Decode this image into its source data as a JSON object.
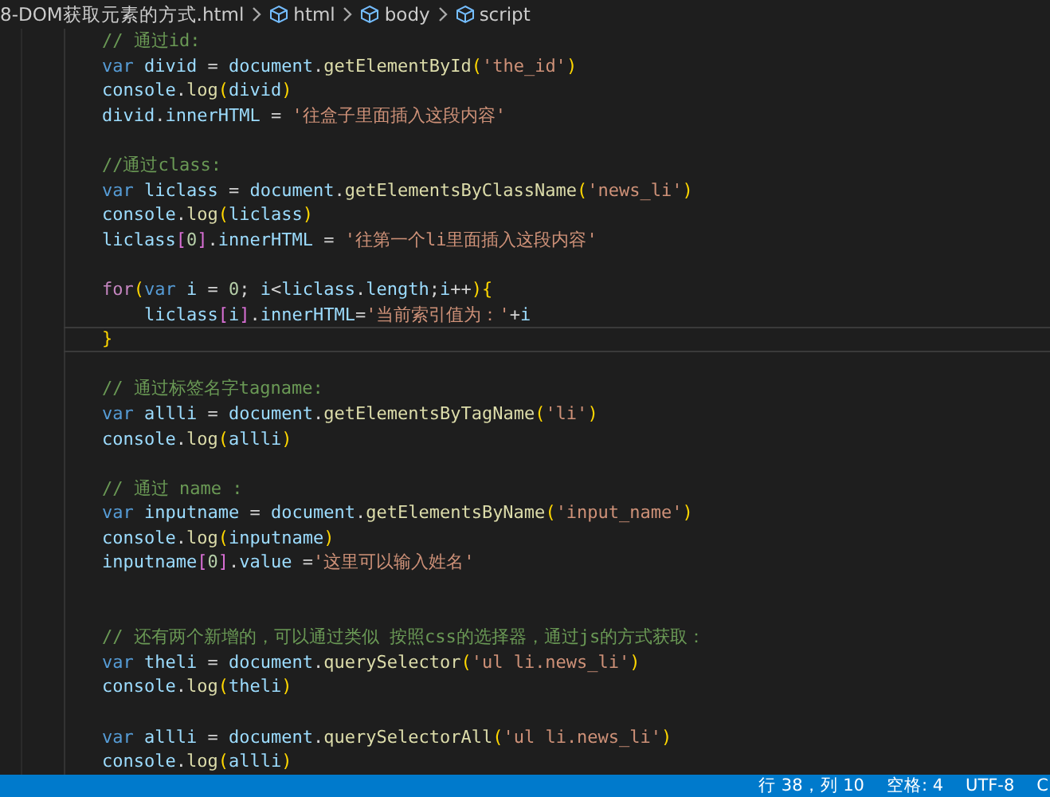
{
  "breadcrumb": [
    {
      "kind": "file",
      "text": "8-DOM获取元素的方式.html"
    },
    {
      "kind": "element",
      "text": "html"
    },
    {
      "kind": "element",
      "text": "body"
    },
    {
      "kind": "element",
      "text": "script"
    }
  ],
  "code_lines": [
    {
      "current": false,
      "tokens": [
        {
          "kind": "comment",
          "text": "// 通过id:"
        }
      ]
    },
    {
      "current": false,
      "tokens": [
        {
          "kind": "keyword",
          "text": "var "
        },
        {
          "kind": "variable",
          "text": "divid"
        },
        {
          "kind": "plain",
          "text": " = "
        },
        {
          "kind": "variable",
          "text": "document"
        },
        {
          "kind": "plain",
          "text": "."
        },
        {
          "kind": "function",
          "text": "getElementById"
        },
        {
          "kind": "bracket",
          "text": "("
        },
        {
          "kind": "string",
          "text": "'the_id'"
        },
        {
          "kind": "bracket",
          "text": ")"
        }
      ]
    },
    {
      "current": false,
      "tokens": [
        {
          "kind": "variable",
          "text": "console"
        },
        {
          "kind": "plain",
          "text": "."
        },
        {
          "kind": "function",
          "text": "log"
        },
        {
          "kind": "bracket",
          "text": "("
        },
        {
          "kind": "variable",
          "text": "divid"
        },
        {
          "kind": "bracket",
          "text": ")"
        }
      ]
    },
    {
      "current": false,
      "tokens": [
        {
          "kind": "variable",
          "text": "divid"
        },
        {
          "kind": "plain",
          "text": "."
        },
        {
          "kind": "variable",
          "text": "innerHTML"
        },
        {
          "kind": "plain",
          "text": " = "
        },
        {
          "kind": "string",
          "text": "'往盒子里面插入这段内容'"
        }
      ]
    },
    {
      "current": false
    },
    {
      "current": false,
      "tokens": [
        {
          "kind": "comment",
          "text": "//通过class:"
        }
      ]
    },
    {
      "current": false,
      "tokens": [
        {
          "kind": "keyword",
          "text": "var "
        },
        {
          "kind": "variable",
          "text": "liclass"
        },
        {
          "kind": "plain",
          "text": " = "
        },
        {
          "kind": "variable",
          "text": "document"
        },
        {
          "kind": "plain",
          "text": "."
        },
        {
          "kind": "function",
          "text": "getElementsByClassName"
        },
        {
          "kind": "bracket",
          "text": "("
        },
        {
          "kind": "string",
          "text": "'news_li'"
        },
        {
          "kind": "bracket",
          "text": ")"
        }
      ]
    },
    {
      "current": false,
      "tokens": [
        {
          "kind": "variable",
          "text": "console"
        },
        {
          "kind": "plain",
          "text": "."
        },
        {
          "kind": "function",
          "text": "log"
        },
        {
          "kind": "bracket",
          "text": "("
        },
        {
          "kind": "variable",
          "text": "liclass"
        },
        {
          "kind": "bracket",
          "text": ")"
        }
      ]
    },
    {
      "current": false,
      "tokens": [
        {
          "kind": "variable",
          "text": "liclass"
        },
        {
          "kind": "bracket2",
          "text": "["
        },
        {
          "kind": "number",
          "text": "0"
        },
        {
          "kind": "bracket2",
          "text": "]"
        },
        {
          "kind": "plain",
          "text": "."
        },
        {
          "kind": "variable",
          "text": "innerHTML"
        },
        {
          "kind": "plain",
          "text": " = "
        },
        {
          "kind": "string",
          "text": "'往第一个li里面插入这段内容'"
        }
      ]
    },
    {
      "current": false
    },
    {
      "current": false,
      "tokens": [
        {
          "kind": "control",
          "text": "for"
        },
        {
          "kind": "bracket",
          "text": "("
        },
        {
          "kind": "keyword",
          "text": "var "
        },
        {
          "kind": "variable",
          "text": "i"
        },
        {
          "kind": "plain",
          "text": " = "
        },
        {
          "kind": "number",
          "text": "0"
        },
        {
          "kind": "plain",
          "text": "; "
        },
        {
          "kind": "variable",
          "text": "i"
        },
        {
          "kind": "plain",
          "text": "<"
        },
        {
          "kind": "variable",
          "text": "liclass"
        },
        {
          "kind": "plain",
          "text": "."
        },
        {
          "kind": "variable",
          "text": "length"
        },
        {
          "kind": "plain",
          "text": ";"
        },
        {
          "kind": "variable",
          "text": "i"
        },
        {
          "kind": "plain",
          "text": "++"
        },
        {
          "kind": "bracket",
          "text": ")"
        },
        {
          "kind": "bracket",
          "text": "{"
        }
      ],
      "children": [
        {
          "current": false,
          "tokens": [
            {
              "kind": "variable",
              "text": "liclass"
            },
            {
              "kind": "bracket2",
              "text": "["
            },
            {
              "kind": "variable",
              "text": "i"
            },
            {
              "kind": "bracket2",
              "text": "]"
            },
            {
              "kind": "plain",
              "text": "."
            },
            {
              "kind": "variable",
              "text": "innerHTML"
            },
            {
              "kind": "plain",
              "text": "="
            },
            {
              "kind": "string",
              "text": "'当前索引值为：'"
            },
            {
              "kind": "plain",
              "text": "+"
            },
            {
              "kind": "variable",
              "text": "i"
            }
          ]
        }
      ]
    },
    {
      "current": true,
      "tokens": [
        {
          "kind": "bracket",
          "text": "}"
        }
      ]
    },
    {
      "current": false
    },
    {
      "current": false,
      "tokens": [
        {
          "kind": "comment",
          "text": "// 通过标签名字tagname:"
        }
      ]
    },
    {
      "current": false,
      "tokens": [
        {
          "kind": "keyword",
          "text": "var "
        },
        {
          "kind": "variable",
          "text": "allli"
        },
        {
          "kind": "plain",
          "text": " = "
        },
        {
          "kind": "variable",
          "text": "document"
        },
        {
          "kind": "plain",
          "text": "."
        },
        {
          "kind": "function",
          "text": "getElementsByTagName"
        },
        {
          "kind": "bracket",
          "text": "("
        },
        {
          "kind": "string",
          "text": "'li'"
        },
        {
          "kind": "bracket",
          "text": ")"
        }
      ]
    },
    {
      "current": false,
      "tokens": [
        {
          "kind": "variable",
          "text": "console"
        },
        {
          "kind": "plain",
          "text": "."
        },
        {
          "kind": "function",
          "text": "log"
        },
        {
          "kind": "bracket",
          "text": "("
        },
        {
          "kind": "variable",
          "text": "allli"
        },
        {
          "kind": "bracket",
          "text": ")"
        }
      ]
    },
    {
      "current": false
    },
    {
      "current": false,
      "tokens": [
        {
          "kind": "comment",
          "text": "// 通过 name :"
        }
      ]
    },
    {
      "current": false,
      "tokens": [
        {
          "kind": "keyword",
          "text": "var "
        },
        {
          "kind": "variable",
          "text": "inputname"
        },
        {
          "kind": "plain",
          "text": " = "
        },
        {
          "kind": "variable",
          "text": "document"
        },
        {
          "kind": "plain",
          "text": "."
        },
        {
          "kind": "function",
          "text": "getElementsByName"
        },
        {
          "kind": "bracket",
          "text": "("
        },
        {
          "kind": "string",
          "text": "'input_name'"
        },
        {
          "kind": "bracket",
          "text": ")"
        }
      ]
    },
    {
      "current": false,
      "tokens": [
        {
          "kind": "variable",
          "text": "console"
        },
        {
          "kind": "plain",
          "text": "."
        },
        {
          "kind": "function",
          "text": "log"
        },
        {
          "kind": "bracket",
          "text": "("
        },
        {
          "kind": "variable",
          "text": "inputname"
        },
        {
          "kind": "bracket",
          "text": ")"
        }
      ]
    },
    {
      "current": false,
      "tokens": [
        {
          "kind": "variable",
          "text": "inputname"
        },
        {
          "kind": "bracket2",
          "text": "["
        },
        {
          "kind": "number",
          "text": "0"
        },
        {
          "kind": "bracket2",
          "text": "]"
        },
        {
          "kind": "plain",
          "text": "."
        },
        {
          "kind": "variable",
          "text": "value"
        },
        {
          "kind": "plain",
          "text": " ="
        },
        {
          "kind": "string",
          "text": "'这里可以输入姓名'"
        }
      ]
    },
    {
      "current": false
    },
    {
      "current": false
    },
    {
      "current": false,
      "tokens": [
        {
          "kind": "comment",
          "text": "// 还有两个新增的，可以通过类似 按照css的选择器，通过js的方式获取："
        }
      ]
    },
    {
      "current": false,
      "tokens": [
        {
          "kind": "keyword",
          "text": "var "
        },
        {
          "kind": "variable",
          "text": "theli"
        },
        {
          "kind": "plain",
          "text": " = "
        },
        {
          "kind": "variable",
          "text": "document"
        },
        {
          "kind": "plain",
          "text": "."
        },
        {
          "kind": "function",
          "text": "querySelector"
        },
        {
          "kind": "bracket",
          "text": "("
        },
        {
          "kind": "string",
          "text": "'ul li.news_li'"
        },
        {
          "kind": "bracket",
          "text": ")"
        }
      ]
    },
    {
      "current": false,
      "tokens": [
        {
          "kind": "variable",
          "text": "console"
        },
        {
          "kind": "plain",
          "text": "."
        },
        {
          "kind": "function",
          "text": "log"
        },
        {
          "kind": "bracket",
          "text": "("
        },
        {
          "kind": "variable",
          "text": "theli"
        },
        {
          "kind": "bracket",
          "text": ")"
        }
      ]
    },
    {
      "current": false
    },
    {
      "current": false,
      "tokens": [
        {
          "kind": "keyword",
          "text": "var "
        },
        {
          "kind": "variable",
          "text": "allli"
        },
        {
          "kind": "plain",
          "text": " = "
        },
        {
          "kind": "variable",
          "text": "document"
        },
        {
          "kind": "plain",
          "text": "."
        },
        {
          "kind": "function",
          "text": "querySelectorAll"
        },
        {
          "kind": "bracket",
          "text": "("
        },
        {
          "kind": "string",
          "text": "'ul li.news_li'"
        },
        {
          "kind": "bracket",
          "text": ")"
        }
      ]
    },
    {
      "current": false,
      "tokens": [
        {
          "kind": "variable",
          "text": "console"
        },
        {
          "kind": "plain",
          "text": "."
        },
        {
          "kind": "function",
          "text": "log"
        },
        {
          "kind": "bracket",
          "text": "("
        },
        {
          "kind": "variable",
          "text": "allli"
        },
        {
          "kind": "bracket",
          "text": ")"
        }
      ]
    }
  ],
  "status_bar": [
    "行 38，列 10",
    "空格: 4",
    "UTF-8",
    "C"
  ]
}
